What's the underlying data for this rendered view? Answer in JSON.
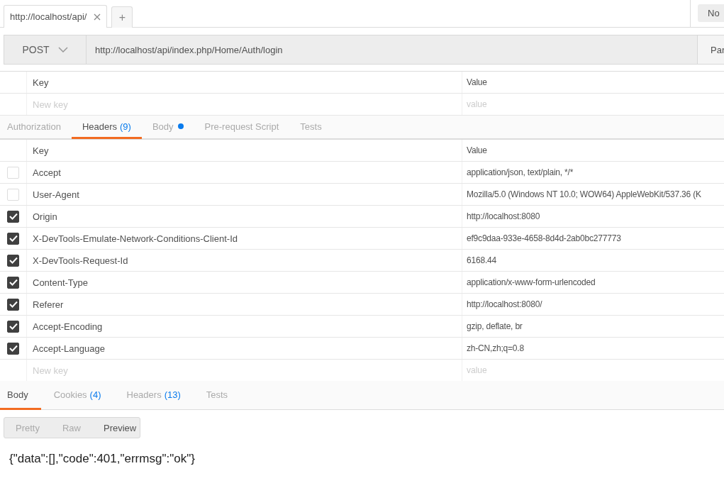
{
  "request_tabs": [
    {
      "label": "http://localhost/api/",
      "selected": true,
      "closable": true
    },
    {
      "label": "+",
      "selected": false,
      "closable": false
    }
  ],
  "environment": {
    "label": "No"
  },
  "url_bar": {
    "method": "POST",
    "url": "http://localhost/api/index.php/Home/Auth/login",
    "params_button": "Par"
  },
  "params_table": {
    "columns": [
      "Key",
      "Value"
    ],
    "new_row": {
      "key_placeholder": "New key",
      "value_placeholder": "value"
    }
  },
  "section_tabs": [
    {
      "label": "Authorization",
      "dot": false,
      "selected": false
    },
    {
      "label": "Headers",
      "count": "(9)",
      "dot": false,
      "selected": true
    },
    {
      "label": "Body",
      "dot": true,
      "selected": false
    },
    {
      "label": "Pre-request Script",
      "dot": false,
      "selected": false
    },
    {
      "label": "Tests",
      "dot": false,
      "selected": false
    }
  ],
  "headers_table": {
    "columns": [
      "Key",
      "Value"
    ],
    "rows": [
      {
        "checked": false,
        "key": "Accept",
        "value": "application/json, text/plain, */*"
      },
      {
        "checked": false,
        "key": "User-Agent",
        "value": "Mozilla/5.0 (Windows NT 10.0; WOW64) AppleWebKit/537.36 (K"
      },
      {
        "checked": true,
        "key": "Origin",
        "value": "http://localhost:8080"
      },
      {
        "checked": true,
        "key": "X-DevTools-Emulate-Network-Conditions-Client-Id",
        "value": "ef9c9daa-933e-4658-8d4d-2ab0bc277773"
      },
      {
        "checked": true,
        "key": "X-DevTools-Request-Id",
        "value": "6168.44"
      },
      {
        "checked": true,
        "key": "Content-Type",
        "value": "application/x-www-form-urlencoded"
      },
      {
        "checked": true,
        "key": "Referer",
        "value": "http://localhost:8080/"
      },
      {
        "checked": true,
        "key": "Accept-Encoding",
        "value": "gzip, deflate, br"
      },
      {
        "checked": true,
        "key": "Accept-Language",
        "value": "zh-CN,zh;q=0.8"
      }
    ],
    "new_row": {
      "key_placeholder": "New key",
      "value_placeholder": "value"
    }
  },
  "response_tabs": [
    {
      "label": "Body",
      "selected": true
    },
    {
      "label": "Cookies",
      "count": "(4)",
      "selected": false
    },
    {
      "label": "Headers",
      "count": "(13)",
      "selected": false
    },
    {
      "label": "Tests",
      "selected": false
    }
  ],
  "view_modes": [
    {
      "label": "Pretty",
      "selected": false
    },
    {
      "label": "Raw",
      "selected": false
    },
    {
      "label": "Preview",
      "selected": true
    }
  ],
  "response_body": "{\"data\":[],\"code\":401,\"errmsg\":\"ok\"}"
}
